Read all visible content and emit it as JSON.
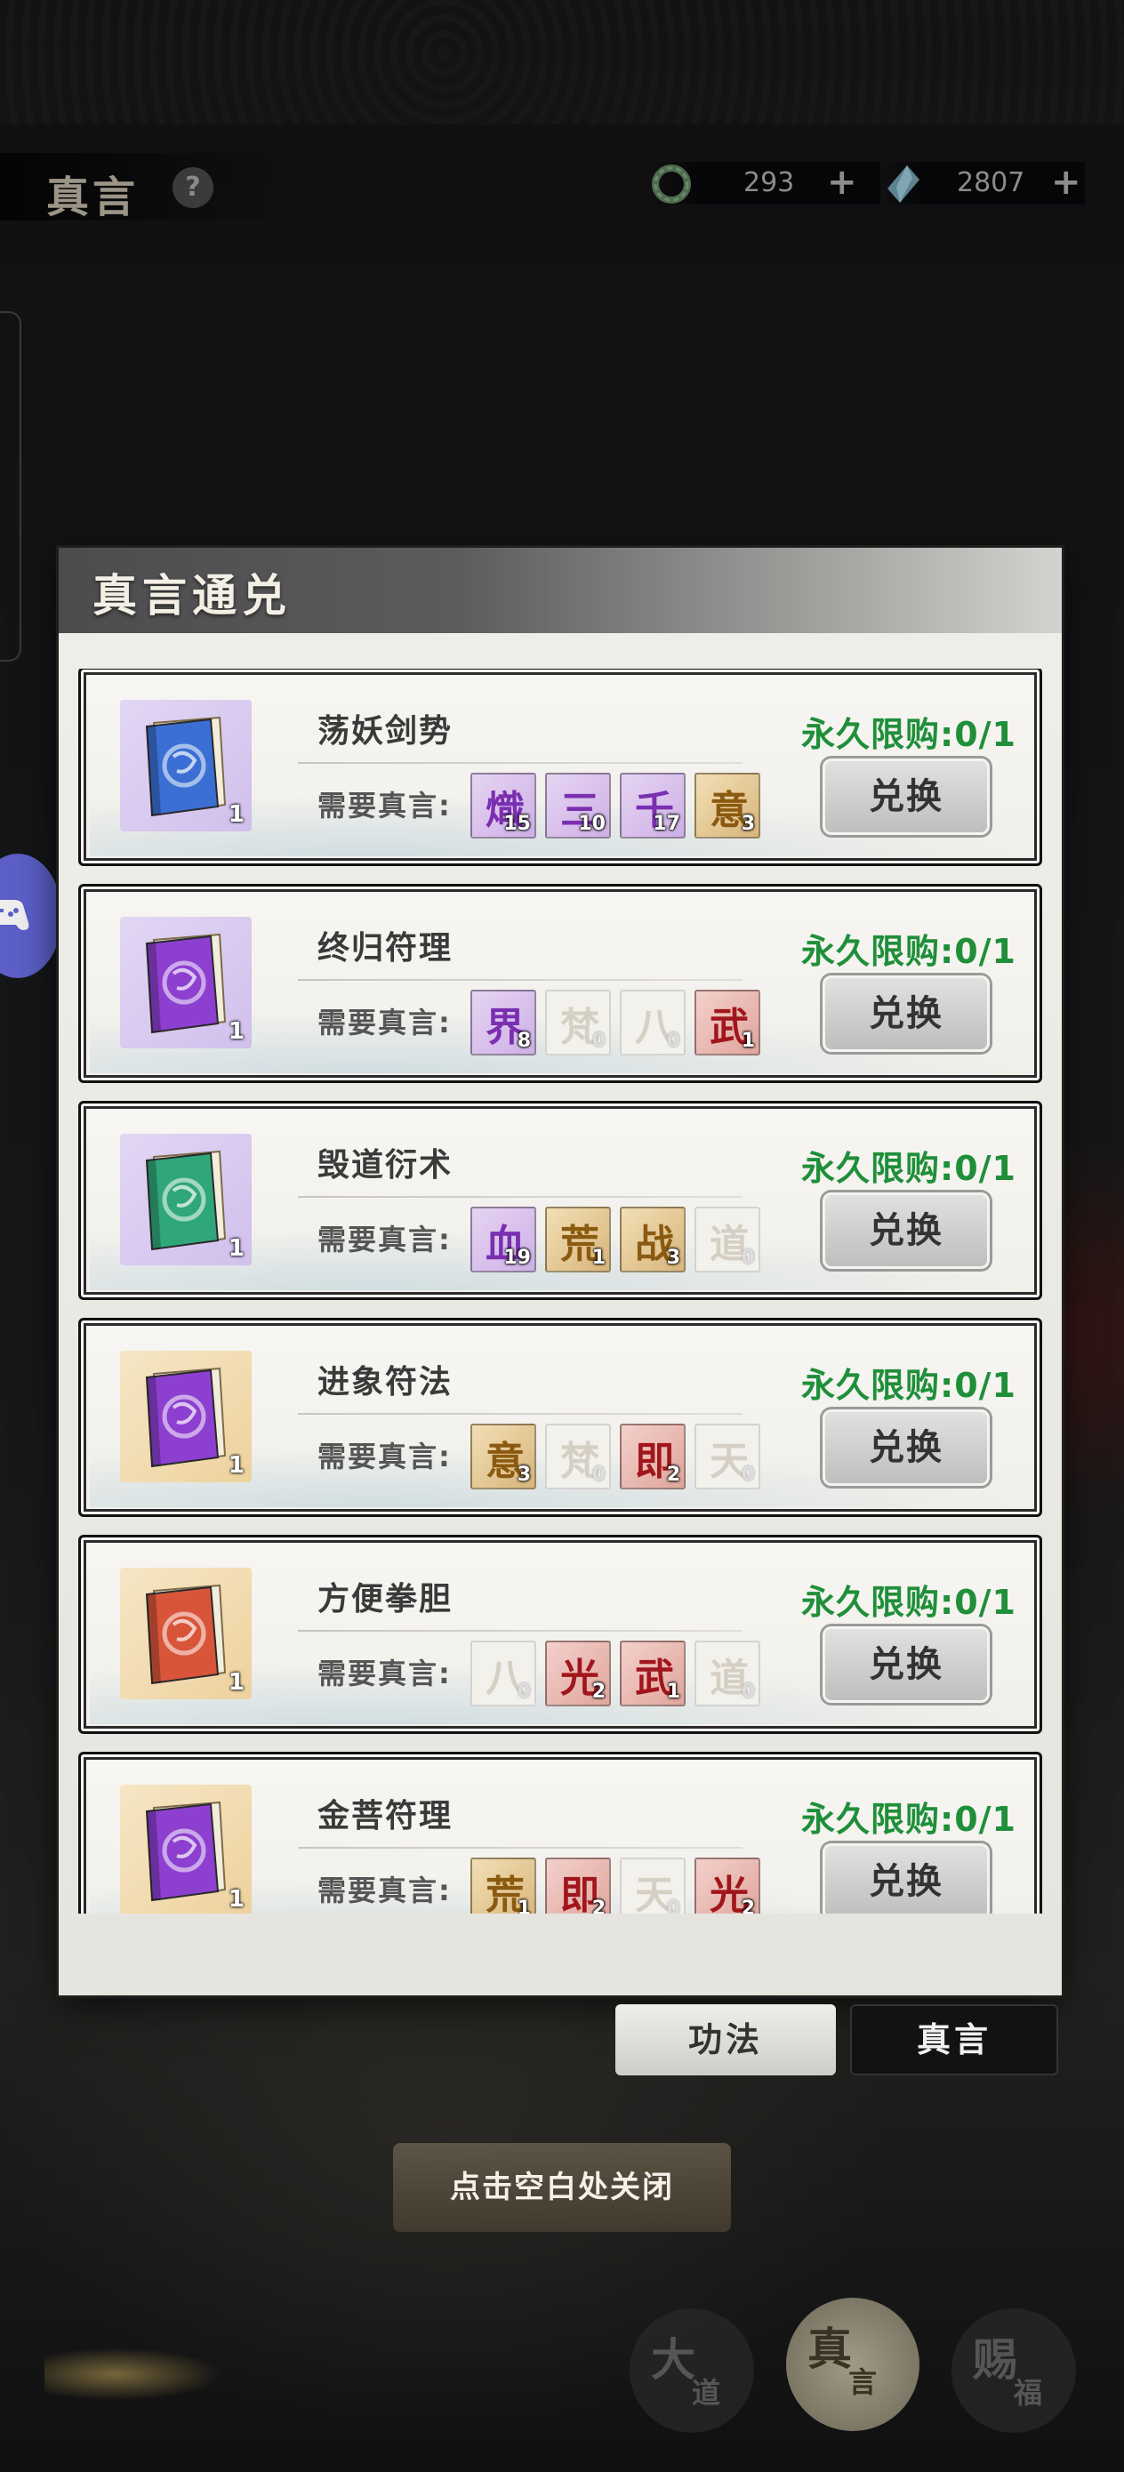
{
  "header": {
    "title": "真言",
    "help_symbol": "?",
    "jade_amount": "293",
    "crystal_amount": "2807",
    "plus_symbol": "+"
  },
  "dialog": {
    "title": "真言通兑",
    "requirement_label": "需要真言:",
    "button_label": "兑换",
    "items": [
      {
        "name": "荡妖剑势",
        "limit": "永久限购:0/1",
        "count": "1",
        "book_color": "blue",
        "costs": [
          {
            "glyph": "熾",
            "count": "15",
            "tone": "purple"
          },
          {
            "glyph": "三",
            "count": "10",
            "tone": "purple"
          },
          {
            "glyph": "千",
            "count": "17",
            "tone": "purple"
          },
          {
            "glyph": "意",
            "count": "3",
            "tone": "gold"
          }
        ]
      },
      {
        "name": "终归符理",
        "limit": "永久限购:0/1",
        "count": "1",
        "book_color": "purple",
        "costs": [
          {
            "glyph": "界",
            "count": "8",
            "tone": "purple"
          },
          {
            "glyph": "梵",
            "count": "0",
            "tone": "faded"
          },
          {
            "glyph": "八",
            "count": "0",
            "tone": "faded"
          },
          {
            "glyph": "武",
            "count": "1",
            "tone": "red"
          }
        ]
      },
      {
        "name": "毁道衍术",
        "limit": "永久限购:0/1",
        "count": "1",
        "book_color": "green",
        "costs": [
          {
            "glyph": "血",
            "count": "19",
            "tone": "purple"
          },
          {
            "glyph": "荒",
            "count": "1",
            "tone": "gold"
          },
          {
            "glyph": "战",
            "count": "3",
            "tone": "gold"
          },
          {
            "glyph": "道",
            "count": "0",
            "tone": "faded"
          }
        ]
      },
      {
        "name": "进象符法",
        "limit": "永久限购:0/1",
        "count": "1",
        "book_color": "purple",
        "costs": [
          {
            "glyph": "意",
            "count": "3",
            "tone": "gold"
          },
          {
            "glyph": "梵",
            "count": "0",
            "tone": "faded"
          },
          {
            "glyph": "即",
            "count": "2",
            "tone": "red"
          },
          {
            "glyph": "天",
            "count": "0",
            "tone": "faded"
          }
        ]
      },
      {
        "name": "方便拳胆",
        "limit": "永久限购:0/1",
        "count": "1",
        "book_color": "red",
        "costs": [
          {
            "glyph": "八",
            "count": "0",
            "tone": "faded"
          },
          {
            "glyph": "光",
            "count": "2",
            "tone": "red"
          },
          {
            "glyph": "武",
            "count": "1",
            "tone": "red"
          },
          {
            "glyph": "道",
            "count": "0",
            "tone": "faded"
          }
        ]
      },
      {
        "name": "金菩符理",
        "limit": "永久限购:0/1",
        "count": "1",
        "book_color": "purple",
        "costs": [
          {
            "glyph": "荒",
            "count": "1",
            "tone": "gold"
          },
          {
            "glyph": "即",
            "count": "2",
            "tone": "red"
          },
          {
            "glyph": "天",
            "count": "0",
            "tone": "faded"
          },
          {
            "glyph": "光",
            "count": "2",
            "tone": "red"
          }
        ]
      }
    ]
  },
  "tabs": {
    "gongfa": "功法",
    "zhenyan": "真言"
  },
  "close_hint": "点击空白处关闭",
  "bottom_nav": {
    "dadao": {
      "big": "大",
      "small": "道"
    },
    "zhenyan": {
      "big": "真",
      "small": "言"
    },
    "cifu": {
      "big": "赐",
      "small": "福"
    }
  },
  "colors": {
    "limit_green": "#1f8f3a",
    "dialog_bg": "#efeee9",
    "book_blue": "#3b6fd4",
    "book_purple": "#8d3fd0",
    "book_green": "#2fa77a",
    "book_red": "#d9553a"
  }
}
